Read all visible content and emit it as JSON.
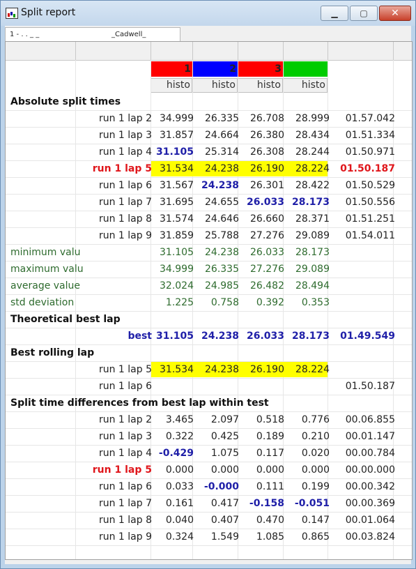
{
  "window": {
    "title": "Split report"
  },
  "tab": {
    "left_text": "1 - . . _ _",
    "right_text": "_Cadwell_"
  },
  "columns": [
    {
      "number": "1",
      "color": "#ff0000",
      "sub": "histo"
    },
    {
      "number": "2",
      "color": "#0000ff",
      "sub": "histo"
    },
    {
      "number": "3",
      "color": "#ff0000",
      "sub": "histo"
    },
    {
      "number": "",
      "color": "#00cc00",
      "sub": "histo"
    }
  ],
  "sections": {
    "absolute": "Absolute split times",
    "theoretical": "Theoretical best lap",
    "rolling": "Best rolling lap",
    "differences": "Split time differences from best lap within test"
  },
  "absolute_rows": [
    {
      "label": "run 1 lap 2",
      "s1": "34.999",
      "s2": "26.335",
      "s3": "26.708",
      "s4": "28.999",
      "total": "01.57.042"
    },
    {
      "label": "run 1 lap 3",
      "s1": "31.857",
      "s2": "24.664",
      "s3": "26.380",
      "s4": "28.434",
      "total": "01.51.334"
    },
    {
      "label": "run 1 lap 4",
      "s1": "31.105",
      "s2": "25.314",
      "s3": "26.308",
      "s4": "28.244",
      "total": "01.50.971"
    },
    {
      "label": "run 1 lap 5",
      "s1": "31.534",
      "s2": "24.238",
      "s3": "26.190",
      "s4": "28.224",
      "total": "01.50.187"
    },
    {
      "label": "run 1 lap 6",
      "s1": "31.567",
      "s2": "24.238",
      "s3": "26.301",
      "s4": "28.422",
      "total": "01.50.529"
    },
    {
      "label": "run 1 lap 7",
      "s1": "31.695",
      "s2": "24.655",
      "s3": "26.033",
      "s4": "28.173",
      "total": "01.50.556"
    },
    {
      "label": "run 1 lap 8",
      "s1": "31.574",
      "s2": "24.646",
      "s3": "26.660",
      "s4": "28.371",
      "total": "01.51.251"
    },
    {
      "label": "run 1 lap 9",
      "s1": "31.859",
      "s2": "25.788",
      "s3": "27.276",
      "s4": "29.089",
      "total": "01.54.011"
    }
  ],
  "stats": [
    {
      "label": "minimum valu",
      "s1": "31.105",
      "s2": "24.238",
      "s3": "26.033",
      "s4": "28.173"
    },
    {
      "label": "maximum valu",
      "s1": "34.999",
      "s2": "26.335",
      "s3": "27.276",
      "s4": "29.089"
    },
    {
      "label": "average value",
      "s1": "32.024",
      "s2": "24.985",
      "s3": "26.482",
      "s4": "28.494"
    },
    {
      "label": "std deviation",
      "s1": "1.225",
      "s2": "0.758",
      "s3": "0.392",
      "s4": "0.353"
    }
  ],
  "best": {
    "label": "best",
    "s1": "31.105",
    "s2": "24.238",
    "s3": "26.033",
    "s4": "28.173",
    "total": "01.49.549"
  },
  "rolling_rows": [
    {
      "label": "run 1 lap 5",
      "s1": "31.534",
      "s2": "24.238",
      "s3": "26.190",
      "s4": "28.224",
      "total": ""
    },
    {
      "label": "run 1 lap 6",
      "s1": "",
      "s2": "",
      "s3": "",
      "s4": "",
      "total": "01.50.187"
    }
  ],
  "diff_rows": [
    {
      "label": "run 1 lap 2",
      "s1": "3.465",
      "s2": "2.097",
      "s3": "0.518",
      "s4": "0.776",
      "total": "00.06.855"
    },
    {
      "label": "run 1 lap 3",
      "s1": "0.322",
      "s2": "0.425",
      "s3": "0.189",
      "s4": "0.210",
      "total": "00.01.147"
    },
    {
      "label": "run 1 lap 4",
      "s1": "-0.429",
      "s2": "1.075",
      "s3": "0.117",
      "s4": "0.020",
      "total": "00.00.784"
    },
    {
      "label": "run 1 lap 5",
      "s1": "0.000",
      "s2": "0.000",
      "s3": "0.000",
      "s4": "0.000",
      "total": "00.00.000"
    },
    {
      "label": "run 1 lap 6",
      "s1": "0.033",
      "s2": "-0.000",
      "s3": "0.111",
      "s4": "0.199",
      "total": "00.00.342"
    },
    {
      "label": "run 1 lap 7",
      "s1": "0.161",
      "s2": "0.417",
      "s3": "-0.158",
      "s4": "-0.051",
      "total": "00.00.369"
    },
    {
      "label": "run 1 lap 8",
      "s1": "0.040",
      "s2": "0.407",
      "s3": "0.470",
      "s4": "0.147",
      "total": "00.01.064"
    },
    {
      "label": "run 1 lap 9",
      "s1": "0.324",
      "s2": "1.549",
      "s3": "1.085",
      "s4": "0.865",
      "total": "00.03.824"
    }
  ],
  "colors": {
    "highlight": "#ffff00",
    "best_blue": "#1f1fa8",
    "best_lap_red": "#e0161b",
    "stats_green": "#2e6b2e"
  }
}
